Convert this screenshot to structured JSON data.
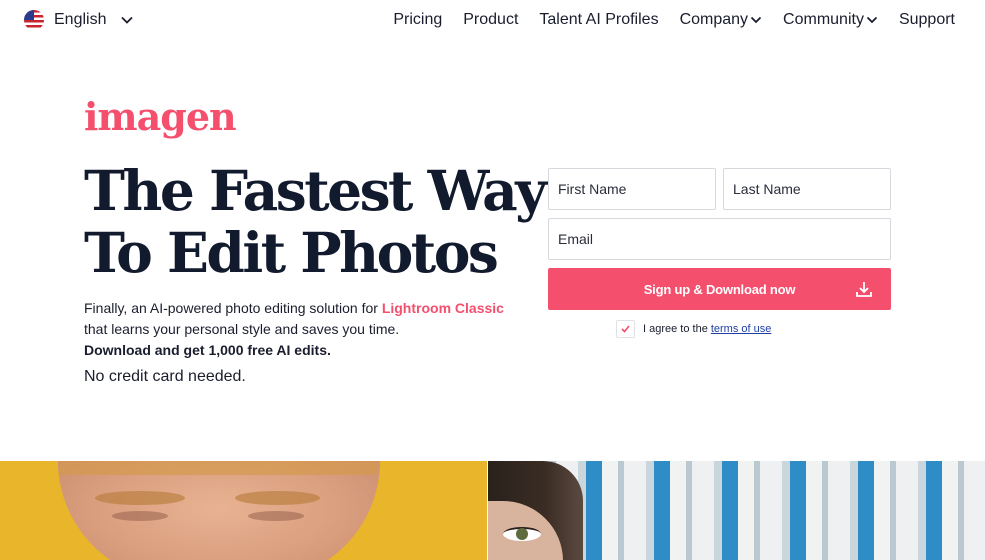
{
  "colors": {
    "accent": "#f4506e",
    "cta_bg": "#f4506e",
    "headline": "#121a2d",
    "link": "#1f3fa6"
  },
  "header": {
    "language": {
      "label": "English",
      "icon": "us-flag-icon"
    },
    "nav": [
      {
        "label": "Pricing",
        "has_dropdown": false
      },
      {
        "label": "Product",
        "has_dropdown": false
      },
      {
        "label": "Talent AI Profiles",
        "has_dropdown": false
      },
      {
        "label": "Company",
        "has_dropdown": true
      },
      {
        "label": "Community",
        "has_dropdown": true
      },
      {
        "label": "Support",
        "has_dropdown": false
      }
    ]
  },
  "hero": {
    "logo": "imagen",
    "headline_line1": "The Fastest Way",
    "headline_line2": "To Edit Photos",
    "desc_part1": "Finally, an AI-powered photo editing solution for ",
    "desc_accent": "Lightroom Classic",
    "desc_part2": "that learns your personal style and saves you time.",
    "desc_bold": "Download and get 1,000 free AI edits.",
    "no_card": "No credit card needed."
  },
  "form": {
    "first_name_placeholder": "First Name",
    "last_name_placeholder": "Last Name",
    "email_placeholder": "Email",
    "cta_label": "Sign up & Download now",
    "agree_checked": true,
    "agree_text": "I agree to the",
    "terms_link": "terms of use"
  }
}
